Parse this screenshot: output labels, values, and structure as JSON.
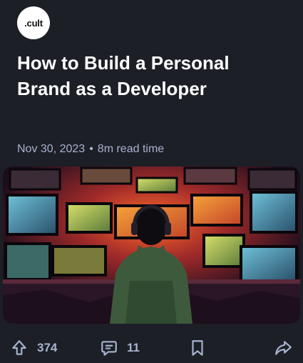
{
  "brand": {
    "logo_text": ".cult"
  },
  "post": {
    "title": "How to Build a Personal Brand as a Developer",
    "date": "Nov 30, 2023",
    "separator": "•",
    "read_time": "8m read time",
    "cover_image": "developer-at-monitor-wall"
  },
  "actions": {
    "upvotes": "374",
    "comments": "11",
    "icons": [
      "upvote-icon",
      "comment-icon",
      "bookmark-icon",
      "share-icon"
    ]
  }
}
